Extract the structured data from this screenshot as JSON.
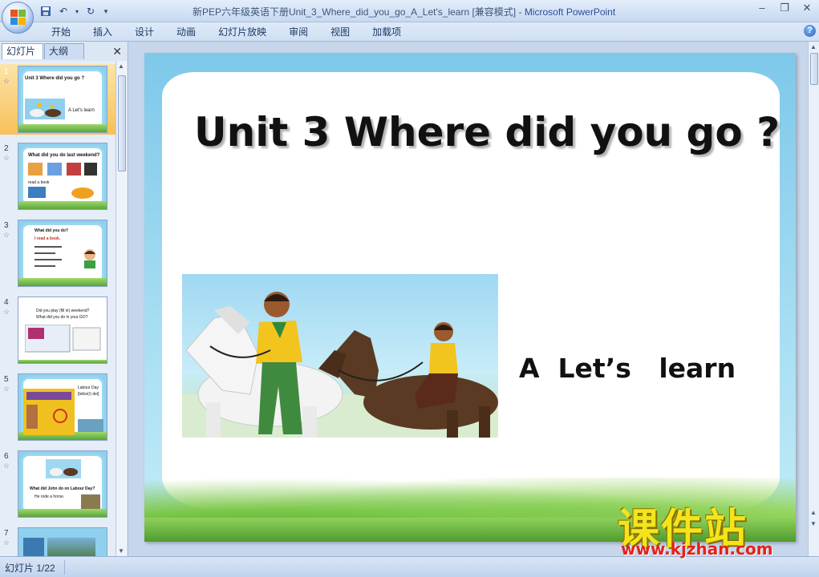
{
  "window": {
    "title": "新PEP六年级英语下册Unit_3_Where_did_you_go_A_Let's_learn [兼容模式]",
    "separator": " - ",
    "app": "Microsoft PowerPoint"
  },
  "ribbon": {
    "tabs": [
      "开始",
      "插入",
      "设计",
      "动画",
      "幻灯片放映",
      "审阅",
      "视图",
      "加载项"
    ]
  },
  "left_pane": {
    "tab_slides": "幻灯片",
    "tab_outline": "大纲",
    "thumbnails": [
      {
        "number": "1",
        "line1": "Unit 3 Where did you go ?",
        "line2": "A  Let's  learn"
      },
      {
        "number": "2",
        "line1": "What did you do last weekend?",
        "line2": "read a book"
      },
      {
        "number": "3",
        "line1": "What did you do?",
        "line2": "I read a book."
      },
      {
        "number": "4",
        "line1": "Did you play (fill in) weekend?",
        "line2": "What did you do in your GO?"
      },
      {
        "number": "5",
        "line1": "Labour Day",
        "line2": "[leibə(r) dei]"
      },
      {
        "number": "6",
        "line1": "What did John do on Labour Day?",
        "line2": "He rode a horse."
      },
      {
        "number": "7",
        "line1": "",
        "line2": ""
      }
    ]
  },
  "slide": {
    "title": "Unit 3 Where did you go ?",
    "subtitle": "A  Let’s   learn"
  },
  "watermark": {
    "name": "课件站",
    "url": "www.kjzhan.com"
  },
  "status": {
    "slide_indicator": "幻灯片 1/22"
  },
  "colors": {
    "accent": "#2d4f9c",
    "selected_thumb": "#f7c05a",
    "sky": "#7ec8ea",
    "grass": "#7cc84a",
    "watermark_yellow": "#f2e51c",
    "watermark_red": "#e3221b"
  }
}
